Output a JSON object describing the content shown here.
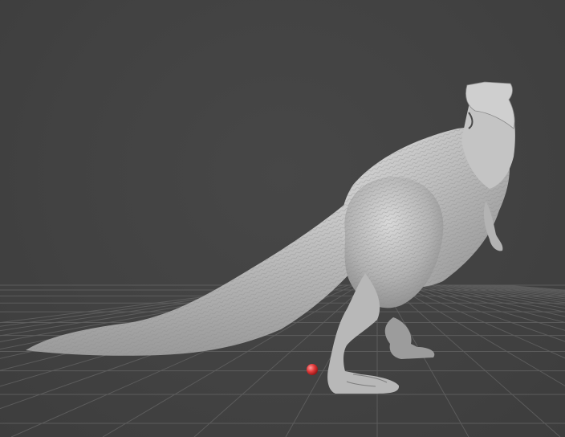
{
  "viewport": {
    "background_color": "#434343",
    "grid_color": "#5c5c5c",
    "model": {
      "name": "tyrannosaurus",
      "color": "#b9b9b9"
    },
    "marker": {
      "color": "#e23b3b"
    }
  }
}
